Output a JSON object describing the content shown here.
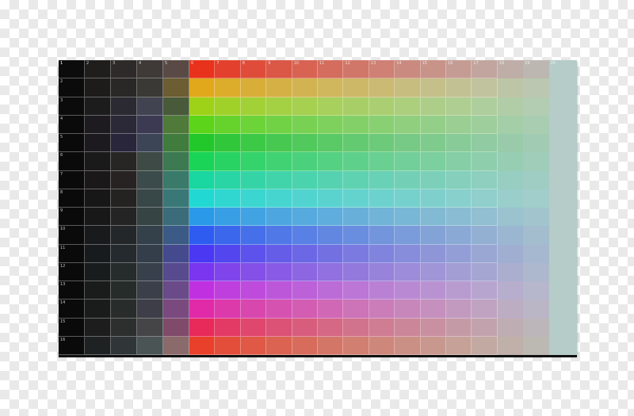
{
  "column_labels": [
    "1",
    "2",
    "3",
    "4",
    "5",
    "6",
    "7",
    "8",
    "9",
    "10",
    "11",
    "12",
    "13",
    "14",
    "15",
    "16",
    "17",
    "18",
    "19",
    "20"
  ],
  "row_labels": [
    "1",
    "2",
    "3",
    "4",
    "5",
    "6",
    "7",
    "8",
    "9",
    "10",
    "11",
    "12",
    "13",
    "14",
    "15",
    "16"
  ],
  "colors": {
    "checker_light": "#ffffff",
    "checker_dark": "#e9e9e9",
    "fade_target": "#b5ccc9",
    "dark_columns": [
      [
        "#0c0c0c",
        "#201d1d",
        "#2e2a2a",
        "#3f3938",
        "#5a4a46"
      ],
      [
        "#0b0b0b",
        "#1e1c1b",
        "#2a2826",
        "#3a3935",
        "#6c5d32"
      ],
      [
        "#0b0b0b",
        "#1c1c1d",
        "#2b2a32",
        "#414450",
        "#485a3a"
      ],
      [
        "#0a0a0a",
        "#1d1b20",
        "#2b2837",
        "#3c3a53",
        "#4f7a3a"
      ],
      [
        "#0a0a0a",
        "#1c1a1e",
        "#29253a",
        "#3c4555",
        "#3f7c3e"
      ],
      [
        "#0a0a0a",
        "#1b1a1a",
        "#282525",
        "#3d4a45",
        "#3d7a52"
      ],
      [
        "#0a0a0a",
        "#1a1818",
        "#272323",
        "#3b4a4a",
        "#3a7a6a"
      ],
      [
        "#0a0a0a",
        "#181717",
        "#252222",
        "#384747",
        "#3a7878"
      ],
      [
        "#0a0a0a",
        "#181818",
        "#242424",
        "#364444",
        "#3a6c7a"
      ],
      [
        "#0a0a0a",
        "#181a1b",
        "#242729",
        "#34404a",
        "#3b5a86"
      ],
      [
        "#0a0a0a",
        "#181b1d",
        "#242a2e",
        "#343e4a",
        "#454a8e"
      ],
      [
        "#0a0a0a",
        "#181c1c",
        "#252c2b",
        "#37404b",
        "#574a8e"
      ],
      [
        "#0a0a0a",
        "#191c1b",
        "#262c2a",
        "#3a3f4a",
        "#6a4a88"
      ],
      [
        "#0a0a0a",
        "#1a1c1b",
        "#282c2a",
        "#3e3e48",
        "#7a4a7e"
      ],
      [
        "#0a0a0a",
        "#1c1d1c",
        "#2d2f2e",
        "#454548",
        "#804a6a"
      ],
      [
        "#0a0a0a",
        "#1e2223",
        "#303637",
        "#4a5455",
        "#8a6a6a"
      ]
    ],
    "hue_rows": [
      "#e8321c",
      "#e0a81a",
      "#9ed218",
      "#5cd41a",
      "#22c82a",
      "#1ad458",
      "#1ad6a0",
      "#22d8d2",
      "#2a9ae8",
      "#2e5cf0",
      "#4a38f2",
      "#7a36ee",
      "#c030e0",
      "#e02aa8",
      "#e82a5a",
      "#e8402a"
    ]
  }
}
